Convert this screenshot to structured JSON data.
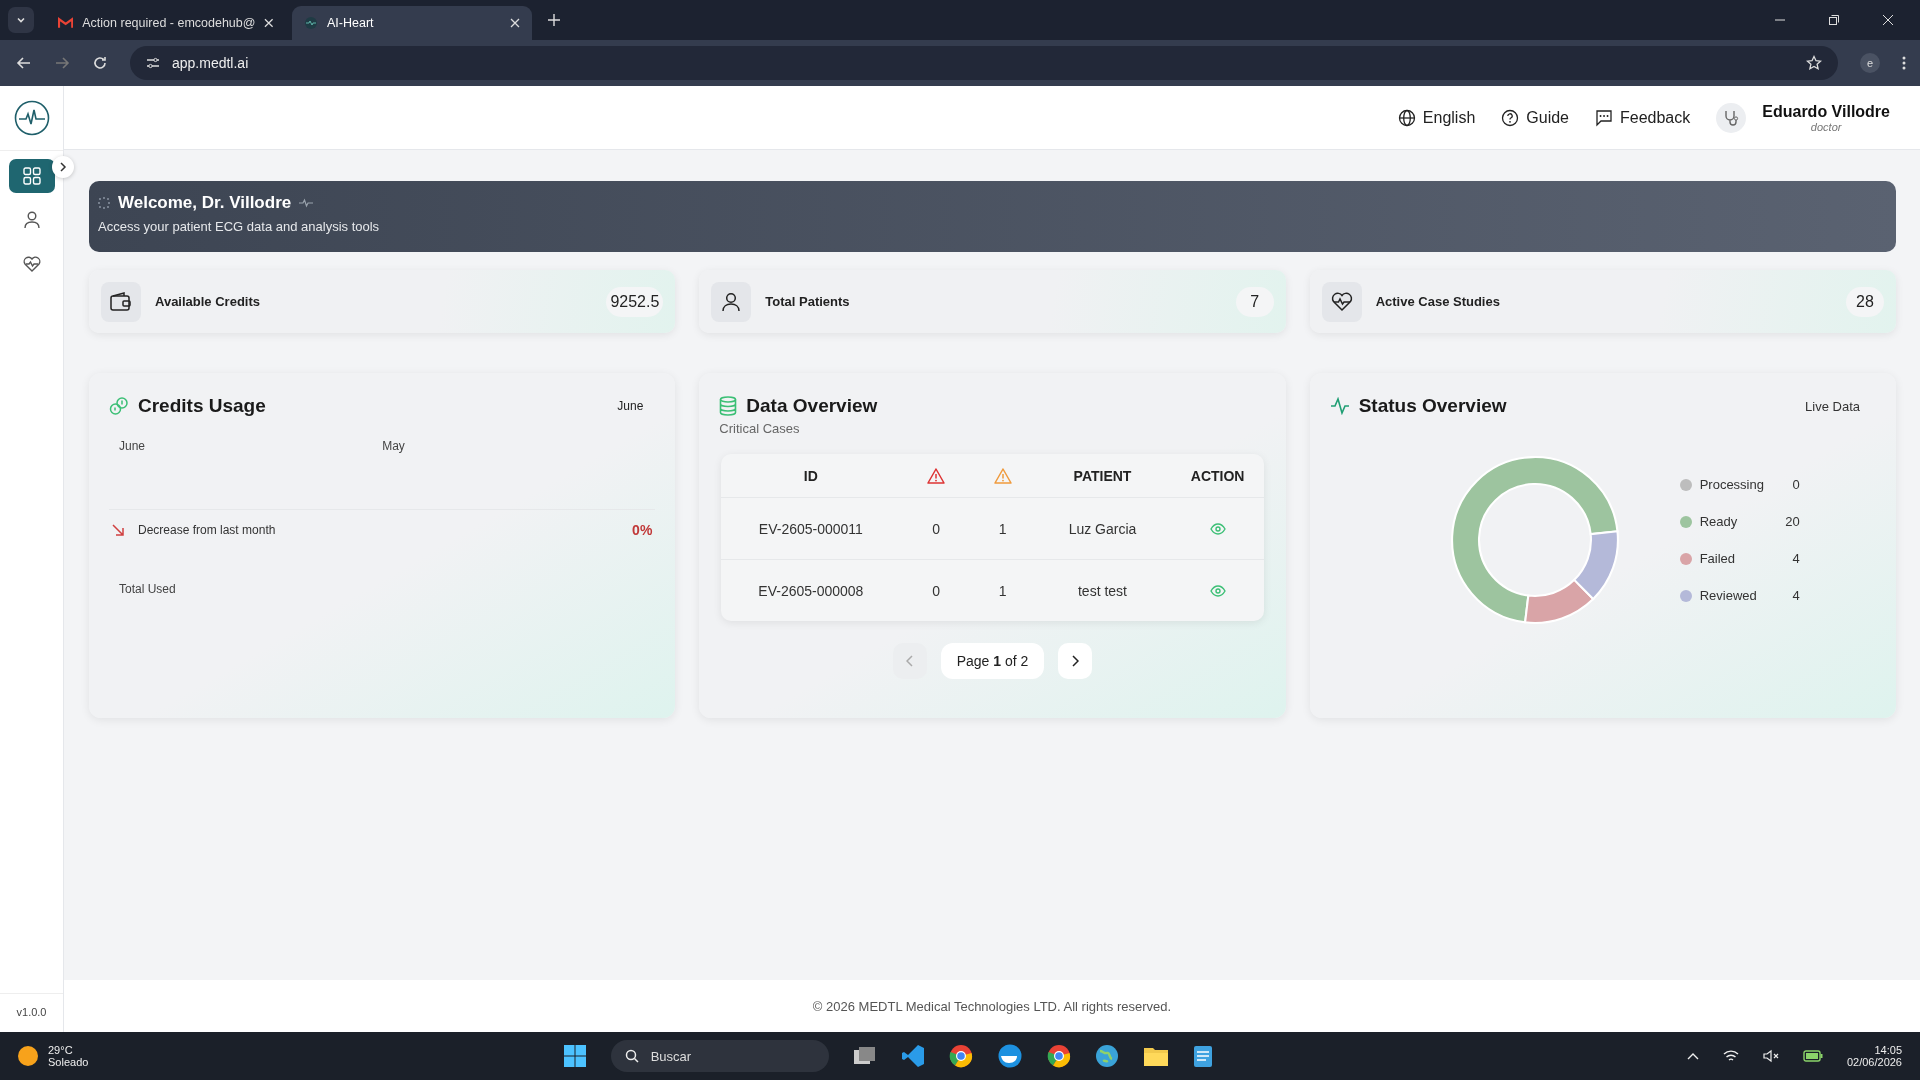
{
  "browser": {
    "tabs": [
      {
        "title": "Action required - emcodehub@",
        "selected": false
      },
      {
        "title": "AI-Heart",
        "selected": true
      }
    ],
    "address": "app.medtl.ai",
    "profile": "e"
  },
  "header": {
    "nav": [
      {
        "kind": "language",
        "label": "English"
      },
      {
        "kind": "guide",
        "label": "Guide"
      },
      {
        "kind": "feedback",
        "label": "Feedback"
      }
    ],
    "user": {
      "name": "Eduardo Villodre",
      "role": "doctor"
    }
  },
  "sidebar": {
    "items": [
      {
        "kind": "dashboard",
        "selected": true
      },
      {
        "kind": "patients",
        "selected": false
      },
      {
        "kind": "cases",
        "selected": false
      }
    ],
    "version": "v1.0.0"
  },
  "welcome": {
    "title": "Welcome, Dr. Villodre",
    "subtitle": "Access your patient ECG data and analysis tools"
  },
  "stats": [
    {
      "kind": "wallet",
      "label": "Available Credits",
      "value": "9252.5"
    },
    {
      "kind": "person",
      "label": "Total Patients",
      "value": "7"
    },
    {
      "kind": "heart",
      "label": "Active Case Studies",
      "value": "28"
    }
  ],
  "credits_usage": {
    "title": "Credits Usage",
    "month": "June",
    "current": "June",
    "previous": "May",
    "trend_label": "Decrease from last month",
    "trend_value": "0%",
    "total_label": "Total Used"
  },
  "data_overview": {
    "title": "Data Overview",
    "subtitle": "Critical Cases",
    "columns": [
      {
        "kind": "text",
        "label": "ID"
      },
      {
        "kind": "critical"
      },
      {
        "kind": "warning"
      },
      {
        "kind": "text",
        "label": "PATIENT"
      },
      {
        "kind": "text",
        "label": "ACTION"
      }
    ],
    "rows": [
      {
        "id": "EV-2605-000011",
        "column_2": "0",
        "column_3": "1",
        "patient": "Luz Garcia"
      },
      {
        "id": "EV-2605-000008",
        "column_2": "0",
        "column_3": "1",
        "patient": "test test"
      }
    ],
    "pagination": {
      "label": "Page **1** of 2",
      "prev_disabled": true,
      "next_disabled": false
    }
  },
  "status_overview": {
    "title": "Status Overview",
    "badge": "Live Data",
    "legend": [
      {
        "count": "0",
        "color": "#bdbdbd"
      },
      {
        "count": "20",
        "color": "#9dc49f"
      },
      {
        "count": "4",
        "color": "#d9a4a7"
      },
      {
        "count": "4",
        "color": "#b4b9d9"
      }
    ],
    "chart_data": {
      "type": "donut",
      "categories": [
        "Processing",
        "Ready",
        "Failed",
        "Reviewed"
      ],
      "values": [
        0,
        71.43,
        14.29,
        14.28
      ]
    }
  },
  "footer": "© 2026 MEDTL Medical Technologies LTD. All rights reserved.",
  "taskbar": {
    "temperature": "29°C",
    "weather": "Soleado",
    "search_placeholder": "Buscar",
    "time": "14:05",
    "date": "02/06/2026"
  }
}
